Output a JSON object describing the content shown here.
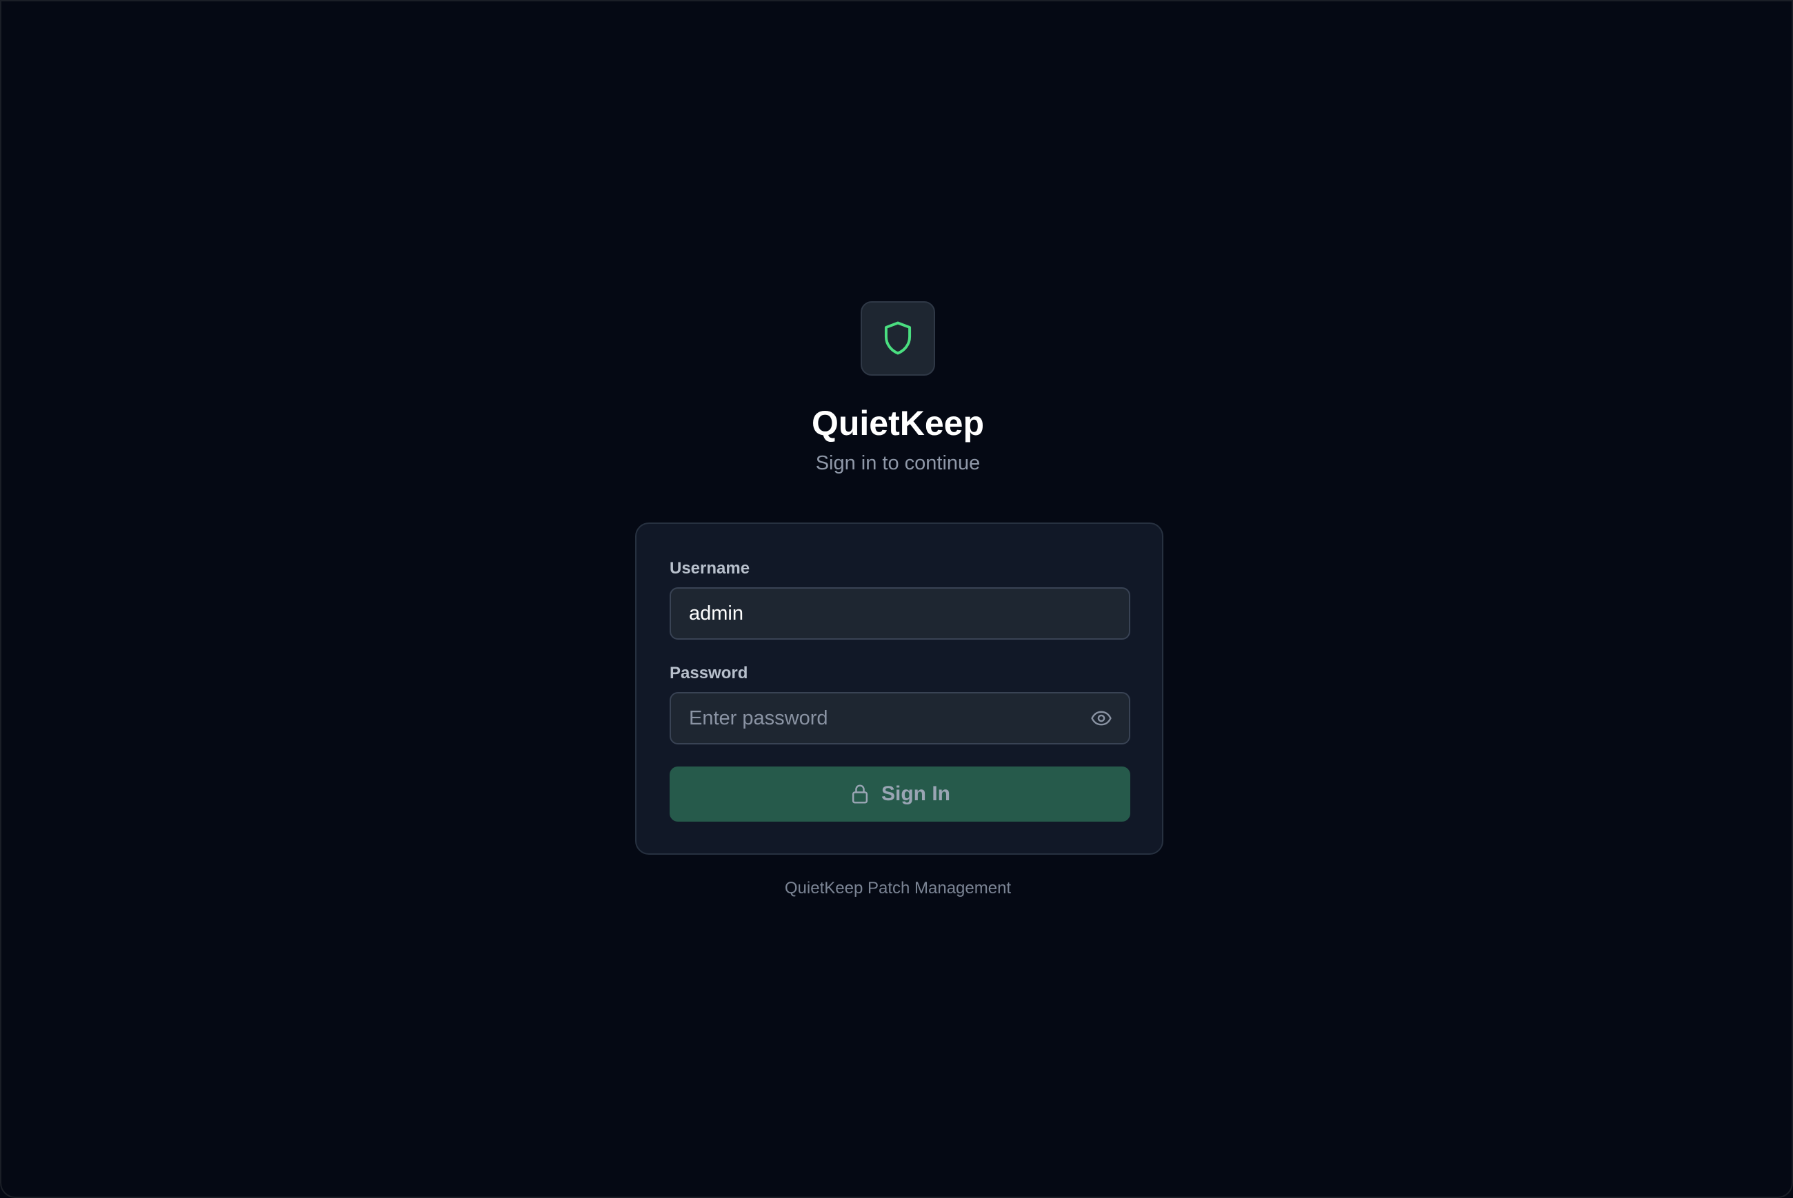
{
  "app": {
    "name": "QuietKeep",
    "subtitle": "Sign in to continue",
    "logo_icon": "shield-icon",
    "accent_color": "#4ade80"
  },
  "form": {
    "username": {
      "label": "Username",
      "value": "admin"
    },
    "password": {
      "label": "Password",
      "value": "",
      "placeholder": "Enter password",
      "toggle_icon": "eye-icon"
    },
    "submit": {
      "label": "Sign In",
      "icon": "lock-icon",
      "background": "#265a4b"
    }
  },
  "footer": {
    "text": "QuietKeep Patch Management"
  }
}
